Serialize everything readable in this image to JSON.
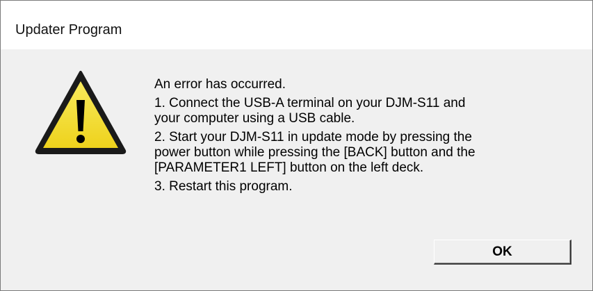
{
  "window": {
    "title": "Updater Program"
  },
  "icon": {
    "name": "warning-icon",
    "colors": {
      "fill": "#f5e23a",
      "outline": "#1a1a1a",
      "glyph": "#000000"
    }
  },
  "message": {
    "lines": [
      "An error has occurred.",
      "1. Connect the USB-A terminal on your DJM-S11 and",
      "your computer using a USB cable.",
      "2. Start your DJM-S11 in update mode by pressing the",
      "power button while pressing the [BACK] button and the",
      "[PARAMETER1 LEFT] button on the left deck.",
      "3. Restart this program."
    ]
  },
  "buttons": {
    "ok_label": "OK"
  }
}
